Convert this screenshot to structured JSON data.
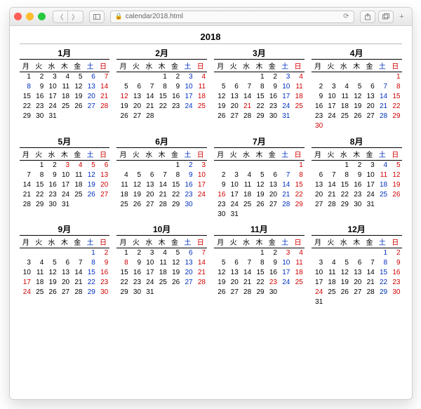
{
  "browser": {
    "url_text": "calendar2018.html"
  },
  "page": {
    "year": "2018",
    "month_suffix": "月",
    "day_headers": [
      "月",
      "火",
      "水",
      "木",
      "金",
      "土",
      "日"
    ],
    "header_colors": [
      "",
      "",
      "",
      "",
      "",
      "blue",
      "red"
    ]
  },
  "months": [
    {
      "m": "1",
      "start": 0,
      "days": 31,
      "red": [
        7
      ],
      "blue": [
        6,
        8
      ]
    },
    {
      "m": "2",
      "start": 3,
      "days": 28,
      "red": [
        11,
        12
      ],
      "blue": []
    },
    {
      "m": "3",
      "start": 3,
      "days": 31,
      "red": [
        21
      ],
      "blue": []
    },
    {
      "m": "4",
      "start": 6,
      "days": 30,
      "red": [
        29,
        30
      ],
      "blue": []
    },
    {
      "m": "5",
      "start": 1,
      "days": 31,
      "red": [
        3,
        4,
        5,
        6
      ],
      "blue": []
    },
    {
      "m": "6",
      "start": 4,
      "days": 30,
      "red": [],
      "blue": []
    },
    {
      "m": "7",
      "start": 6,
      "days": 31,
      "red": [
        16
      ],
      "blue": []
    },
    {
      "m": "8",
      "start": 2,
      "days": 31,
      "red": [
        11
      ],
      "blue": []
    },
    {
      "m": "9",
      "start": 5,
      "days": 30,
      "red": [
        17,
        23,
        24
      ],
      "blue": []
    },
    {
      "m": "10",
      "start": 0,
      "days": 31,
      "red": [
        8
      ],
      "blue": []
    },
    {
      "m": "11",
      "start": 3,
      "days": 30,
      "red": [
        3,
        23
      ],
      "blue": []
    },
    {
      "m": "12",
      "start": 5,
      "days": 31,
      "red": [
        23,
        24
      ],
      "blue": []
    }
  ]
}
